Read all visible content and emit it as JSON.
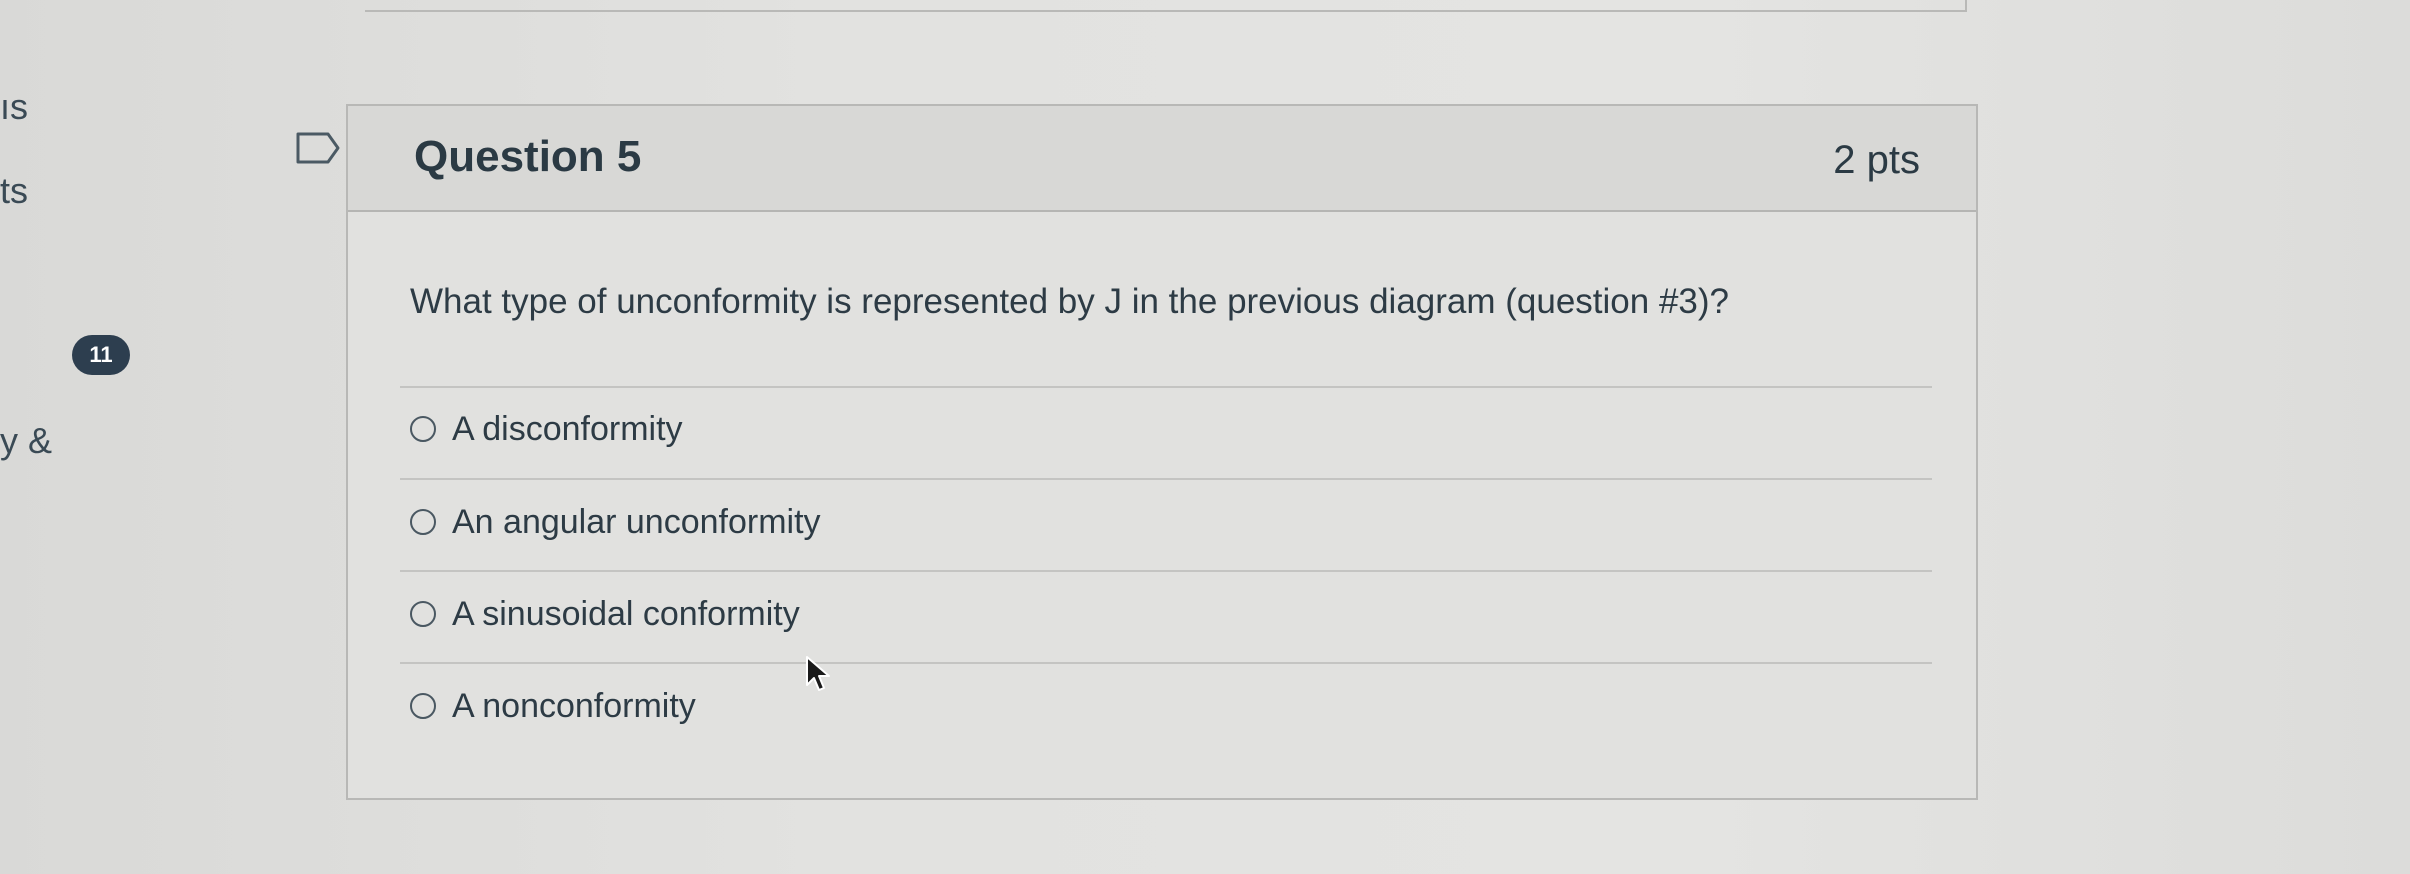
{
  "sidebar": {
    "fragment_1": "ıs",
    "fragment_2": "ts",
    "badge_count": "11",
    "fragment_3": "y &"
  },
  "question": {
    "title": "Question 5",
    "points": "2 pts",
    "text": "What type of unconformity is represented by J in the previous diagram (question #3)?",
    "answers": [
      "A disconformity",
      "An angular unconformity",
      "A sinusoidal conformity",
      "A nonconformity"
    ]
  },
  "icons": {
    "flag": "flag-outline-icon",
    "radio": "radio-unchecked-icon",
    "cursor": "mouse-pointer-icon"
  }
}
